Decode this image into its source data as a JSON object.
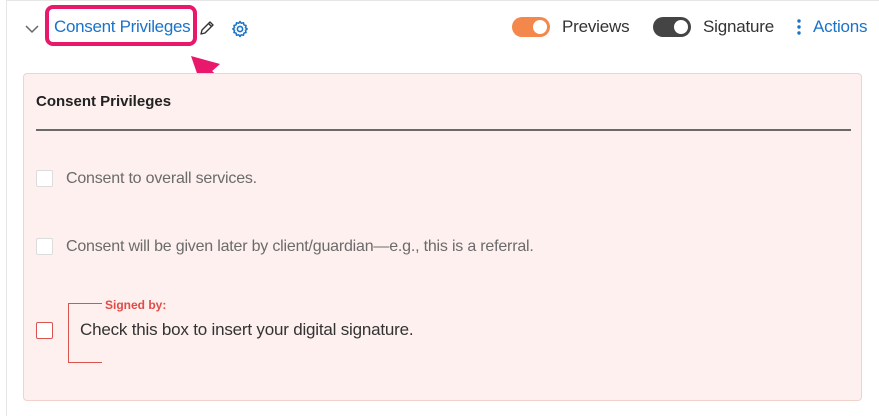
{
  "header": {
    "title": "Consent Privileges",
    "icons": {
      "collapse": "chevron-down-icon",
      "edit": "pencil-icon",
      "settings": "gear-icon",
      "actions": "vertical-dots-icon"
    },
    "toggles": [
      {
        "label": "Previews",
        "on": true,
        "color": "#f4874b"
      },
      {
        "label": "Signature",
        "on": true,
        "color": "#444444"
      }
    ],
    "actions_label": "Actions"
  },
  "panel": {
    "heading": "Consent Privileges",
    "options": [
      {
        "label": "Consent to overall services.",
        "checked": false
      },
      {
        "label": "Consent will be given later by client/guardian—e.g., this is a referral.",
        "checked": false
      }
    ],
    "signature": {
      "label": "Signed by:",
      "text": "Check this box to insert your digital signature.",
      "checked": false
    }
  },
  "colors": {
    "accent": "#1a73c9",
    "highlight": "#e8196b",
    "panel_bg": "#fdf0ee",
    "required": "#d9534f"
  }
}
